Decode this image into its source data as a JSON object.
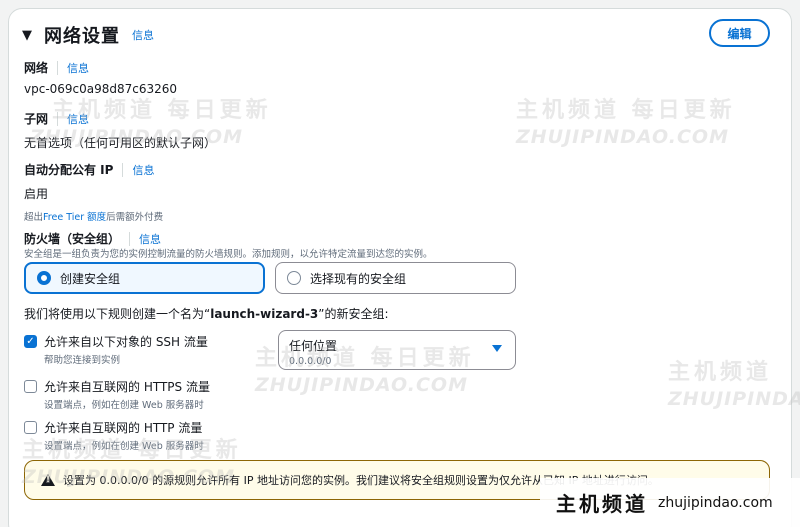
{
  "section": {
    "title": "网络设置",
    "info": "信息",
    "edit": "编辑"
  },
  "network": {
    "label": "网络",
    "info": "信息",
    "value": "vpc-069c0a98d87c63260"
  },
  "subnet": {
    "label": "子网",
    "info": "信息",
    "value": "无首选项（任何可用区的默认子网）"
  },
  "public_ip": {
    "label": "自动分配公有 IP",
    "info": "信息",
    "value": "启用",
    "note_prefix": "超出",
    "note_link": "Free Tier 额度",
    "note_suffix": "后需额外付费"
  },
  "firewall": {
    "label": "防火墙（安全组）",
    "info": "信息",
    "description": "安全组是一组负责为您的实例控制流量的防火墙规则。添加规则，以允许特定流量到达您的实例。",
    "option_create": "创建安全组",
    "option_existing": "选择现有的安全组"
  },
  "rules": {
    "intro_prefix": "我们将使用以下规则创建一个名为“",
    "intro_name": "launch-wizard-3",
    "intro_suffix": "”的新安全组:",
    "ssh": {
      "label": "允许来自以下对象的 SSH 流量",
      "sub": "帮助您连接到实例",
      "checked": true
    },
    "https": {
      "label": "允许来自互联网的 HTTPS 流量",
      "sub": "设置端点，例如在创建 Web 服务器时",
      "checked": false
    },
    "http": {
      "label": "允许来自互联网的 HTTP 流量",
      "sub": "设置端点，例如在创建 Web 服务器时",
      "checked": false
    },
    "source": {
      "value": "任何位置",
      "sub": "0.0.0.0/0"
    }
  },
  "alert": {
    "text": "设置为 0.0.0.0/0 的源规则允许所有 IP 地址访问您的实例。我们建议将安全组规则设置为仅允许从已知 IP 地址进行访问。"
  },
  "watermark": {
    "cn": "主机频道 每日更新",
    "cn_short": "主机频道",
    "en": "ZHUJIPINDAO.COM"
  },
  "brand": {
    "cn": "主机频道",
    "url": "zhujipindao.com"
  },
  "colors": {
    "accent": "#0972d3",
    "alert_border": "#8d6605",
    "alert_bg": "#fffce9"
  }
}
